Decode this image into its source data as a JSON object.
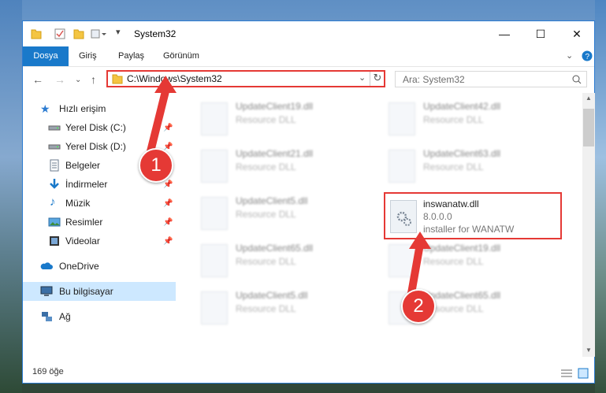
{
  "window": {
    "title": "System32"
  },
  "ribbon": {
    "tabs": [
      "Dosya",
      "Giriş",
      "Paylaş",
      "Görünüm"
    ]
  },
  "address": {
    "path": "C:\\Windows\\System32"
  },
  "search": {
    "placeholder": "Ara: System32"
  },
  "sidebar": {
    "items": [
      {
        "label": "Hızlı erişim",
        "icon": "star-icon",
        "pinned": false
      },
      {
        "label": "Yerel Disk (C:)",
        "icon": "drive-icon",
        "pinned": true
      },
      {
        "label": "Yerel Disk (D:)",
        "icon": "drive-icon",
        "pinned": true
      },
      {
        "label": "Belgeler",
        "icon": "document-icon",
        "pinned": true
      },
      {
        "label": "İndirmeler",
        "icon": "download-icon",
        "pinned": true
      },
      {
        "label": "Müzik",
        "icon": "music-icon",
        "pinned": true
      },
      {
        "label": "Resimler",
        "icon": "pictures-icon",
        "pinned": true
      },
      {
        "label": "Videolar",
        "icon": "video-icon",
        "pinned": true
      },
      {
        "label": "OneDrive",
        "icon": "cloud-icon",
        "pinned": false
      },
      {
        "label": "Bu bilgisayar",
        "icon": "computer-icon",
        "pinned": false
      },
      {
        "label": "Ağ",
        "icon": "network-icon",
        "pinned": false
      }
    ]
  },
  "files": [
    {
      "name": "UpdateClient19.dll",
      "sub": "Resource DLL"
    },
    {
      "name": "UpdateClient42.dll",
      "sub": "Resource DLL"
    },
    {
      "name": "UpdateClient21.dll",
      "sub": "Resource DLL"
    },
    {
      "name": "UpdateClient63.dll",
      "sub": "Resource DLL"
    },
    {
      "name": "UpdateClient5.dll",
      "sub": "Resource DLL"
    },
    {
      "name": "inswanatw.dll",
      "sub": "8.0.0.0",
      "sub2": "installer for WANATW"
    },
    {
      "name": "UpdateClient65.dll",
      "sub": "Resource DLL"
    },
    {
      "name": "UpdateClient19.dll",
      "sub": "Resource DLL"
    },
    {
      "name": "UpdateClient5.dll",
      "sub": "Resource DLL"
    },
    {
      "name": "UpdateClient65.dll",
      "sub": "Resource DLL"
    }
  ],
  "status": {
    "count": "169 öğe"
  },
  "callouts": [
    "1",
    "2"
  ],
  "colors": {
    "accent": "#1979ca",
    "highlight": "#e53935"
  }
}
